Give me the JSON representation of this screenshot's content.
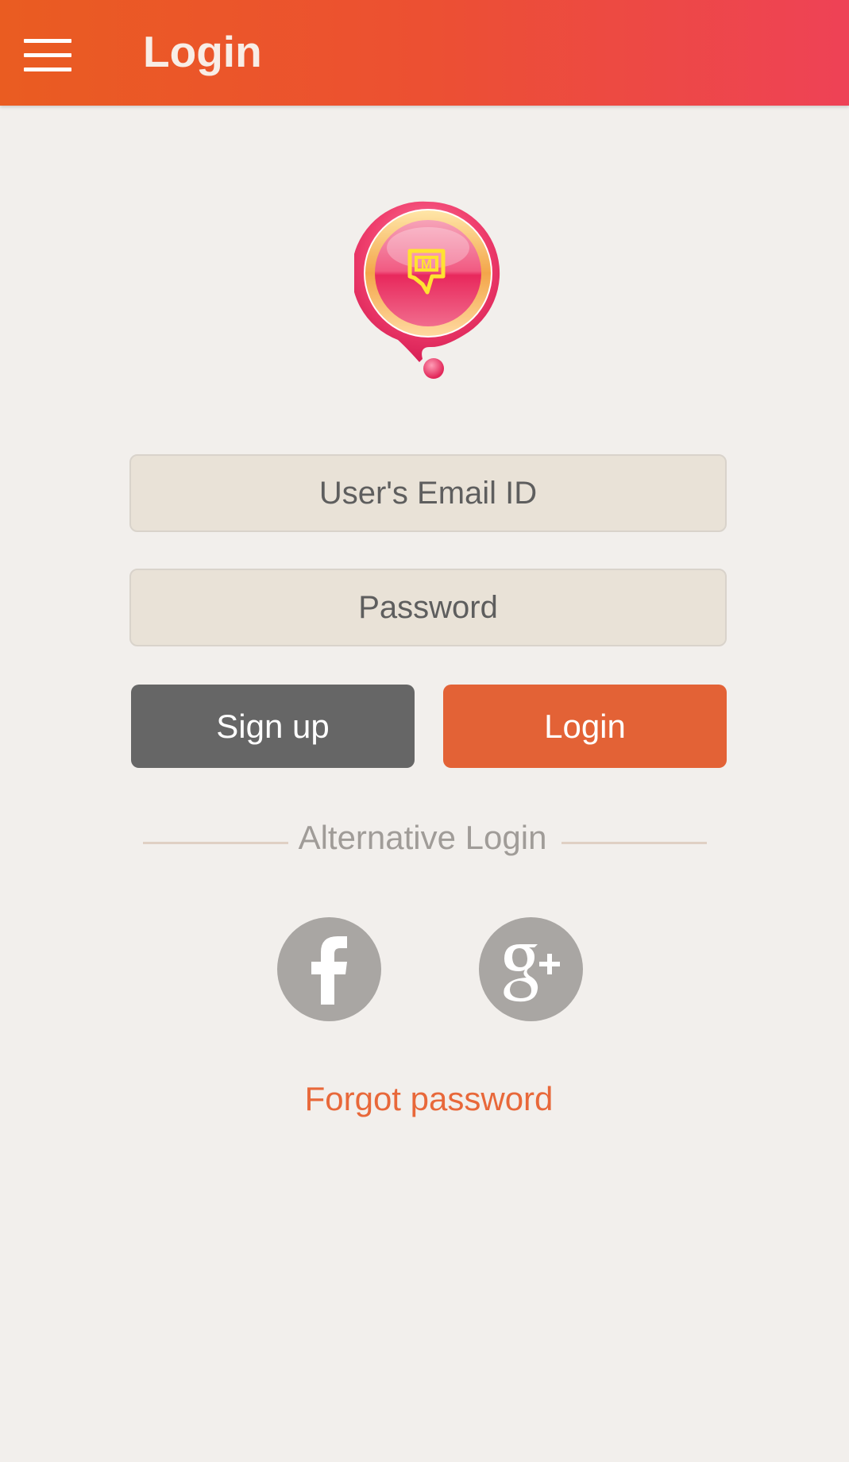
{
  "app_bar": {
    "title": "Login",
    "menu_icon": "hamburger-menu-icon"
  },
  "logo": {
    "icon": "map-pin-logo",
    "mark_letter": "M"
  },
  "form": {
    "email_placeholder": "User's Email ID",
    "password_placeholder": "Password",
    "signup_label": "Sign up",
    "login_label": "Login"
  },
  "alternative": {
    "label": "Alternative Login",
    "facebook_icon": "facebook-icon",
    "google_plus_icon": "google-plus-icon"
  },
  "forgot_password": "Forgot password",
  "colors": {
    "header_gradient_start": "#ea5c21",
    "header_gradient_end": "#ee4256",
    "accent": "#e36236",
    "signup_button": "#666666",
    "background": "#f2efec",
    "field_background": "#e9e2d7",
    "social_icon": "#a9a6a3",
    "link": "#e8683a"
  }
}
